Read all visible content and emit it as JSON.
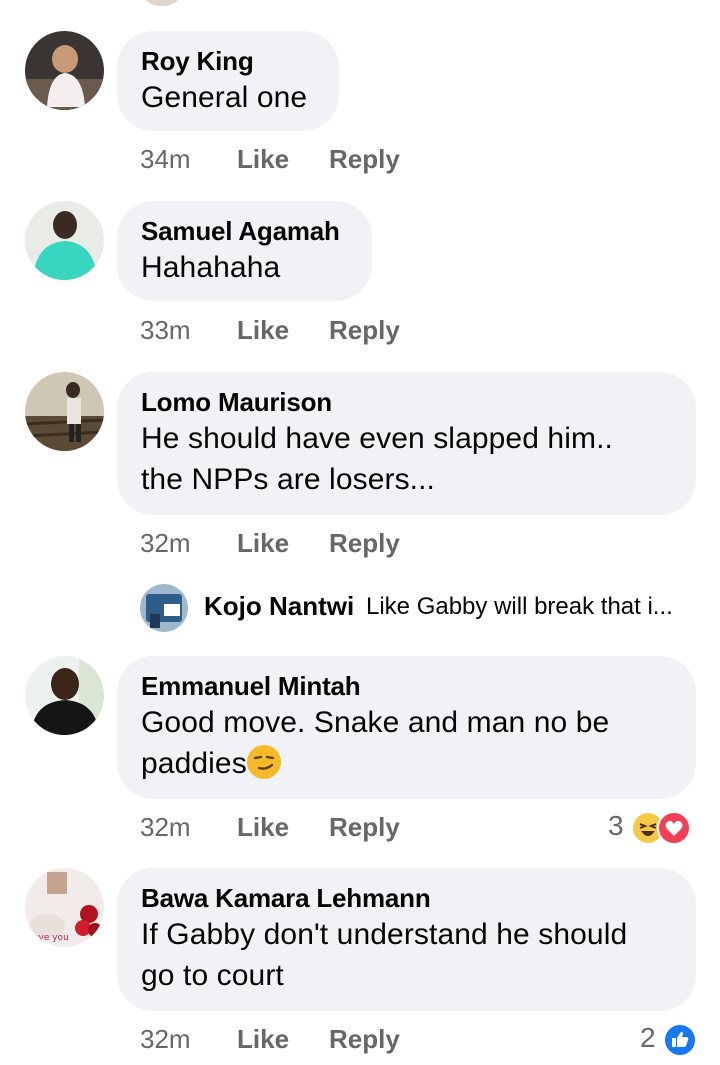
{
  "comments": [
    {
      "name": "Roy King",
      "text": [
        "General one"
      ],
      "time": "34m",
      "like": "Like",
      "reply": "Reply"
    },
    {
      "name": "Samuel Agamah",
      "text": [
        "Hahahaha"
      ],
      "time": "33m",
      "like": "Like",
      "reply": "Reply"
    },
    {
      "name": "Lomo Maurison",
      "text": [
        "He should have even slapped him..",
        "the NPPs are losers..."
      ],
      "time": "32m",
      "like": "Like",
      "reply": "Reply"
    },
    {
      "name": "Emmanuel Mintah",
      "text": [
        "Good move. Snake and man no be",
        "paddies"
      ],
      "time": "32m",
      "like": "Like",
      "reply": "Reply",
      "reaction_count": "3",
      "reactions": [
        "haha-icon",
        "love-icon"
      ]
    },
    {
      "name": "Bawa Kamara Lehmann",
      "text": [
        "If Gabby don't understand he should",
        "go to court"
      ],
      "time": "32m",
      "like": "Like",
      "reply": "Reply",
      "reaction_count": "2",
      "reactions": [
        "like-icon"
      ]
    }
  ],
  "reply_preview": {
    "name": "Kojo Nantwi",
    "text": "Like Gabby will break that i..."
  },
  "colors": {
    "bubble": "#f0f2f5",
    "meta": "#65676b",
    "like_blue": "#1877f2",
    "love_red": "#f33e58",
    "haha_yellow": "#f7c948"
  }
}
